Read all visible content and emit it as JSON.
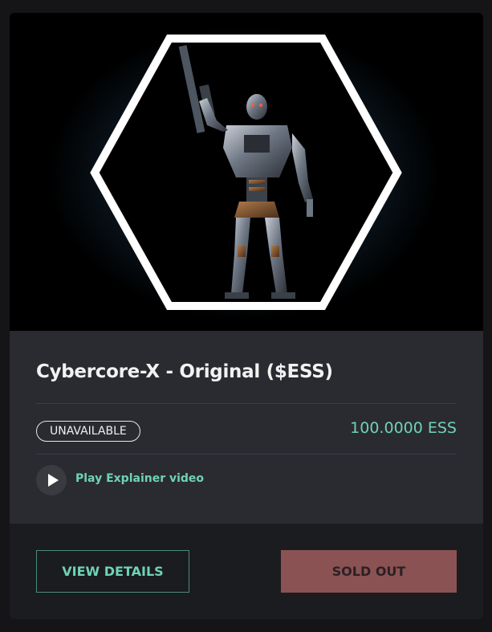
{
  "product": {
    "title": "Cybercore-X - Original ($ESS)",
    "status_badge": "UNAVAILABLE",
    "price": "100.0000 ESS",
    "play_label": "Play Explainer video"
  },
  "actions": {
    "view_details_label": "VIEW DETAILS",
    "sold_out_label": "SOLD OUT"
  },
  "colors": {
    "accent": "#6fd3b3",
    "sold_out_bg": "#8a5252",
    "panel_bg": "#2a2b30",
    "card_bg": "#1b1c20"
  },
  "icons": {
    "play": "play-icon",
    "artwork": "robot-artwork-image"
  }
}
